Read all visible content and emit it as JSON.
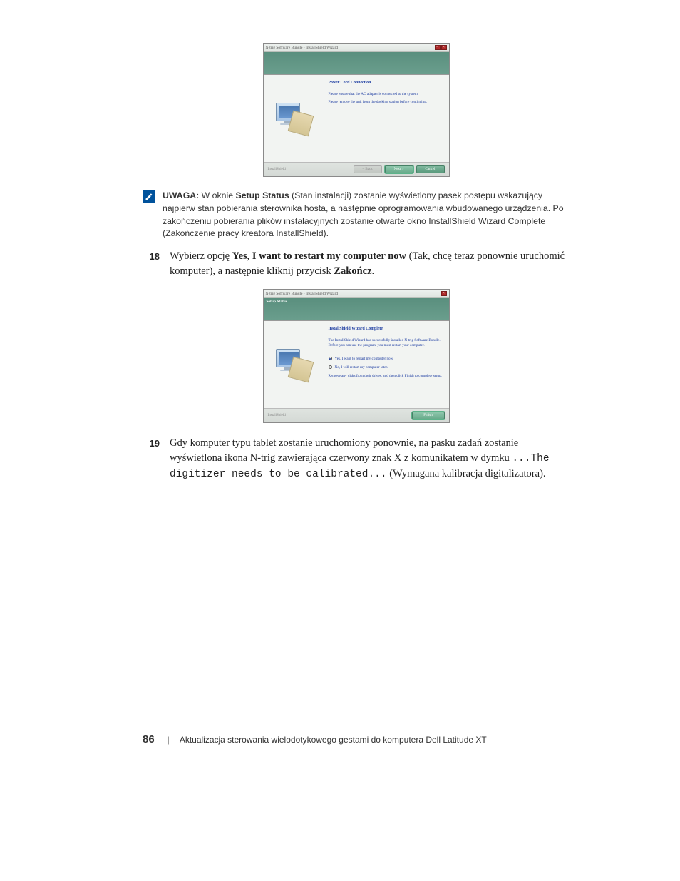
{
  "dialog1": {
    "title": "N-trig Software Bundle - InstallShield Wizard",
    "banner_label": "",
    "content_header": "Power Cord Connection",
    "line1": "Please ensure that the AC adapter is connected to the system.",
    "line2": "Please remove the unit from the docking station before continuing.",
    "btn_installshield": "InstallShield",
    "btn_back": "< Back",
    "btn_next": "Next >",
    "btn_cancel": "Cancel"
  },
  "note": {
    "label": "UWAGA:",
    "text_part1": " W oknie ",
    "bold1": "Setup Status",
    "text_part2": " (Stan instalacji) zostanie wyświetlony pasek postępu wskazujący najpierw stan pobierania sterownika hosta, a następnie oprogramowania wbudowanego urządzenia. Po zakończeniu pobierania plików instalacyjnych zostanie otwarte okno InstallShield Wizard Complete (Zakończenie pracy kreatora InstallShield)."
  },
  "step18": {
    "num": "18",
    "t1": "Wybierz opcję ",
    "b1": "Yes, I want to restart my computer now",
    "t2": " (Tak, chcę teraz ponownie uruchomić komputer), a następnie kliknij przycisk ",
    "b2": "Zakończ",
    "t3": "."
  },
  "dialog2": {
    "title": "N-trig Software Bundle - InstallShield Wizard",
    "banner_label": "Setup Status",
    "content_header": "InstallShield Wizard Complete",
    "line1": "The InstallShield Wizard has successfully installed N-trig Software Bundle. Before you can use the program, you must restart your computer.",
    "opt1": "Yes, I want to restart my computer now.",
    "opt2": "No, I will restart my computer later.",
    "line2": "Remove any disks from their drives, and then click Finish to complete setup.",
    "btn_installshield": "InstallShield",
    "btn_finish": "Finish"
  },
  "step19": {
    "num": "19",
    "t1": "Gdy komputer typu tablet zostanie uruchomiony ponownie, na pasku zadań zostanie wyświetlona ikona N-trig zawierająca czerwony znak X z komunikatem w dymku ",
    "mono1": "...The digitizer needs to be calibrated...",
    "t2": " (Wymagana kalibracja digitalizatora)."
  },
  "footer": {
    "page_num": "86",
    "text": "Aktualizacja sterowania wielodotykowego gestami do komputera Dell Latitude XT"
  }
}
